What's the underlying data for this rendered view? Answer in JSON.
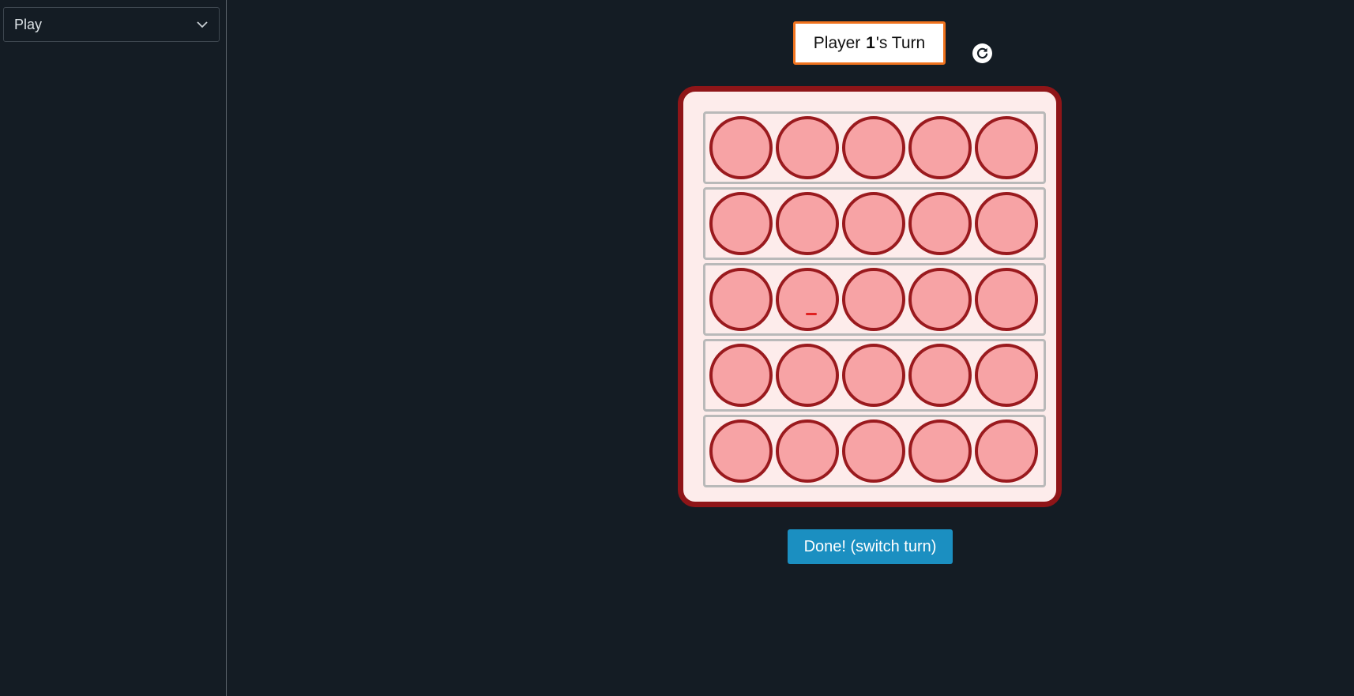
{
  "sidebar": {
    "mode_select": {
      "value": "Play"
    }
  },
  "status": {
    "prefix": "Player ",
    "player_number": "1",
    "suffix": "'s Turn"
  },
  "board": {
    "rows": 5,
    "columns": 5,
    "popped": []
  },
  "actions": {
    "done_label": "Done! (switch turn)"
  },
  "colors": {
    "background": "#141c24",
    "board_fill": "#fdeceb",
    "board_border": "#8f1518",
    "bubble_fill": "#f7a3a5",
    "bubble_border": "#9a1a1e",
    "status_border": "#f0731e",
    "done_button": "#1b8fc1"
  },
  "icons": {
    "mode_select": "chevron-down-icon",
    "reset": "reset-icon"
  }
}
